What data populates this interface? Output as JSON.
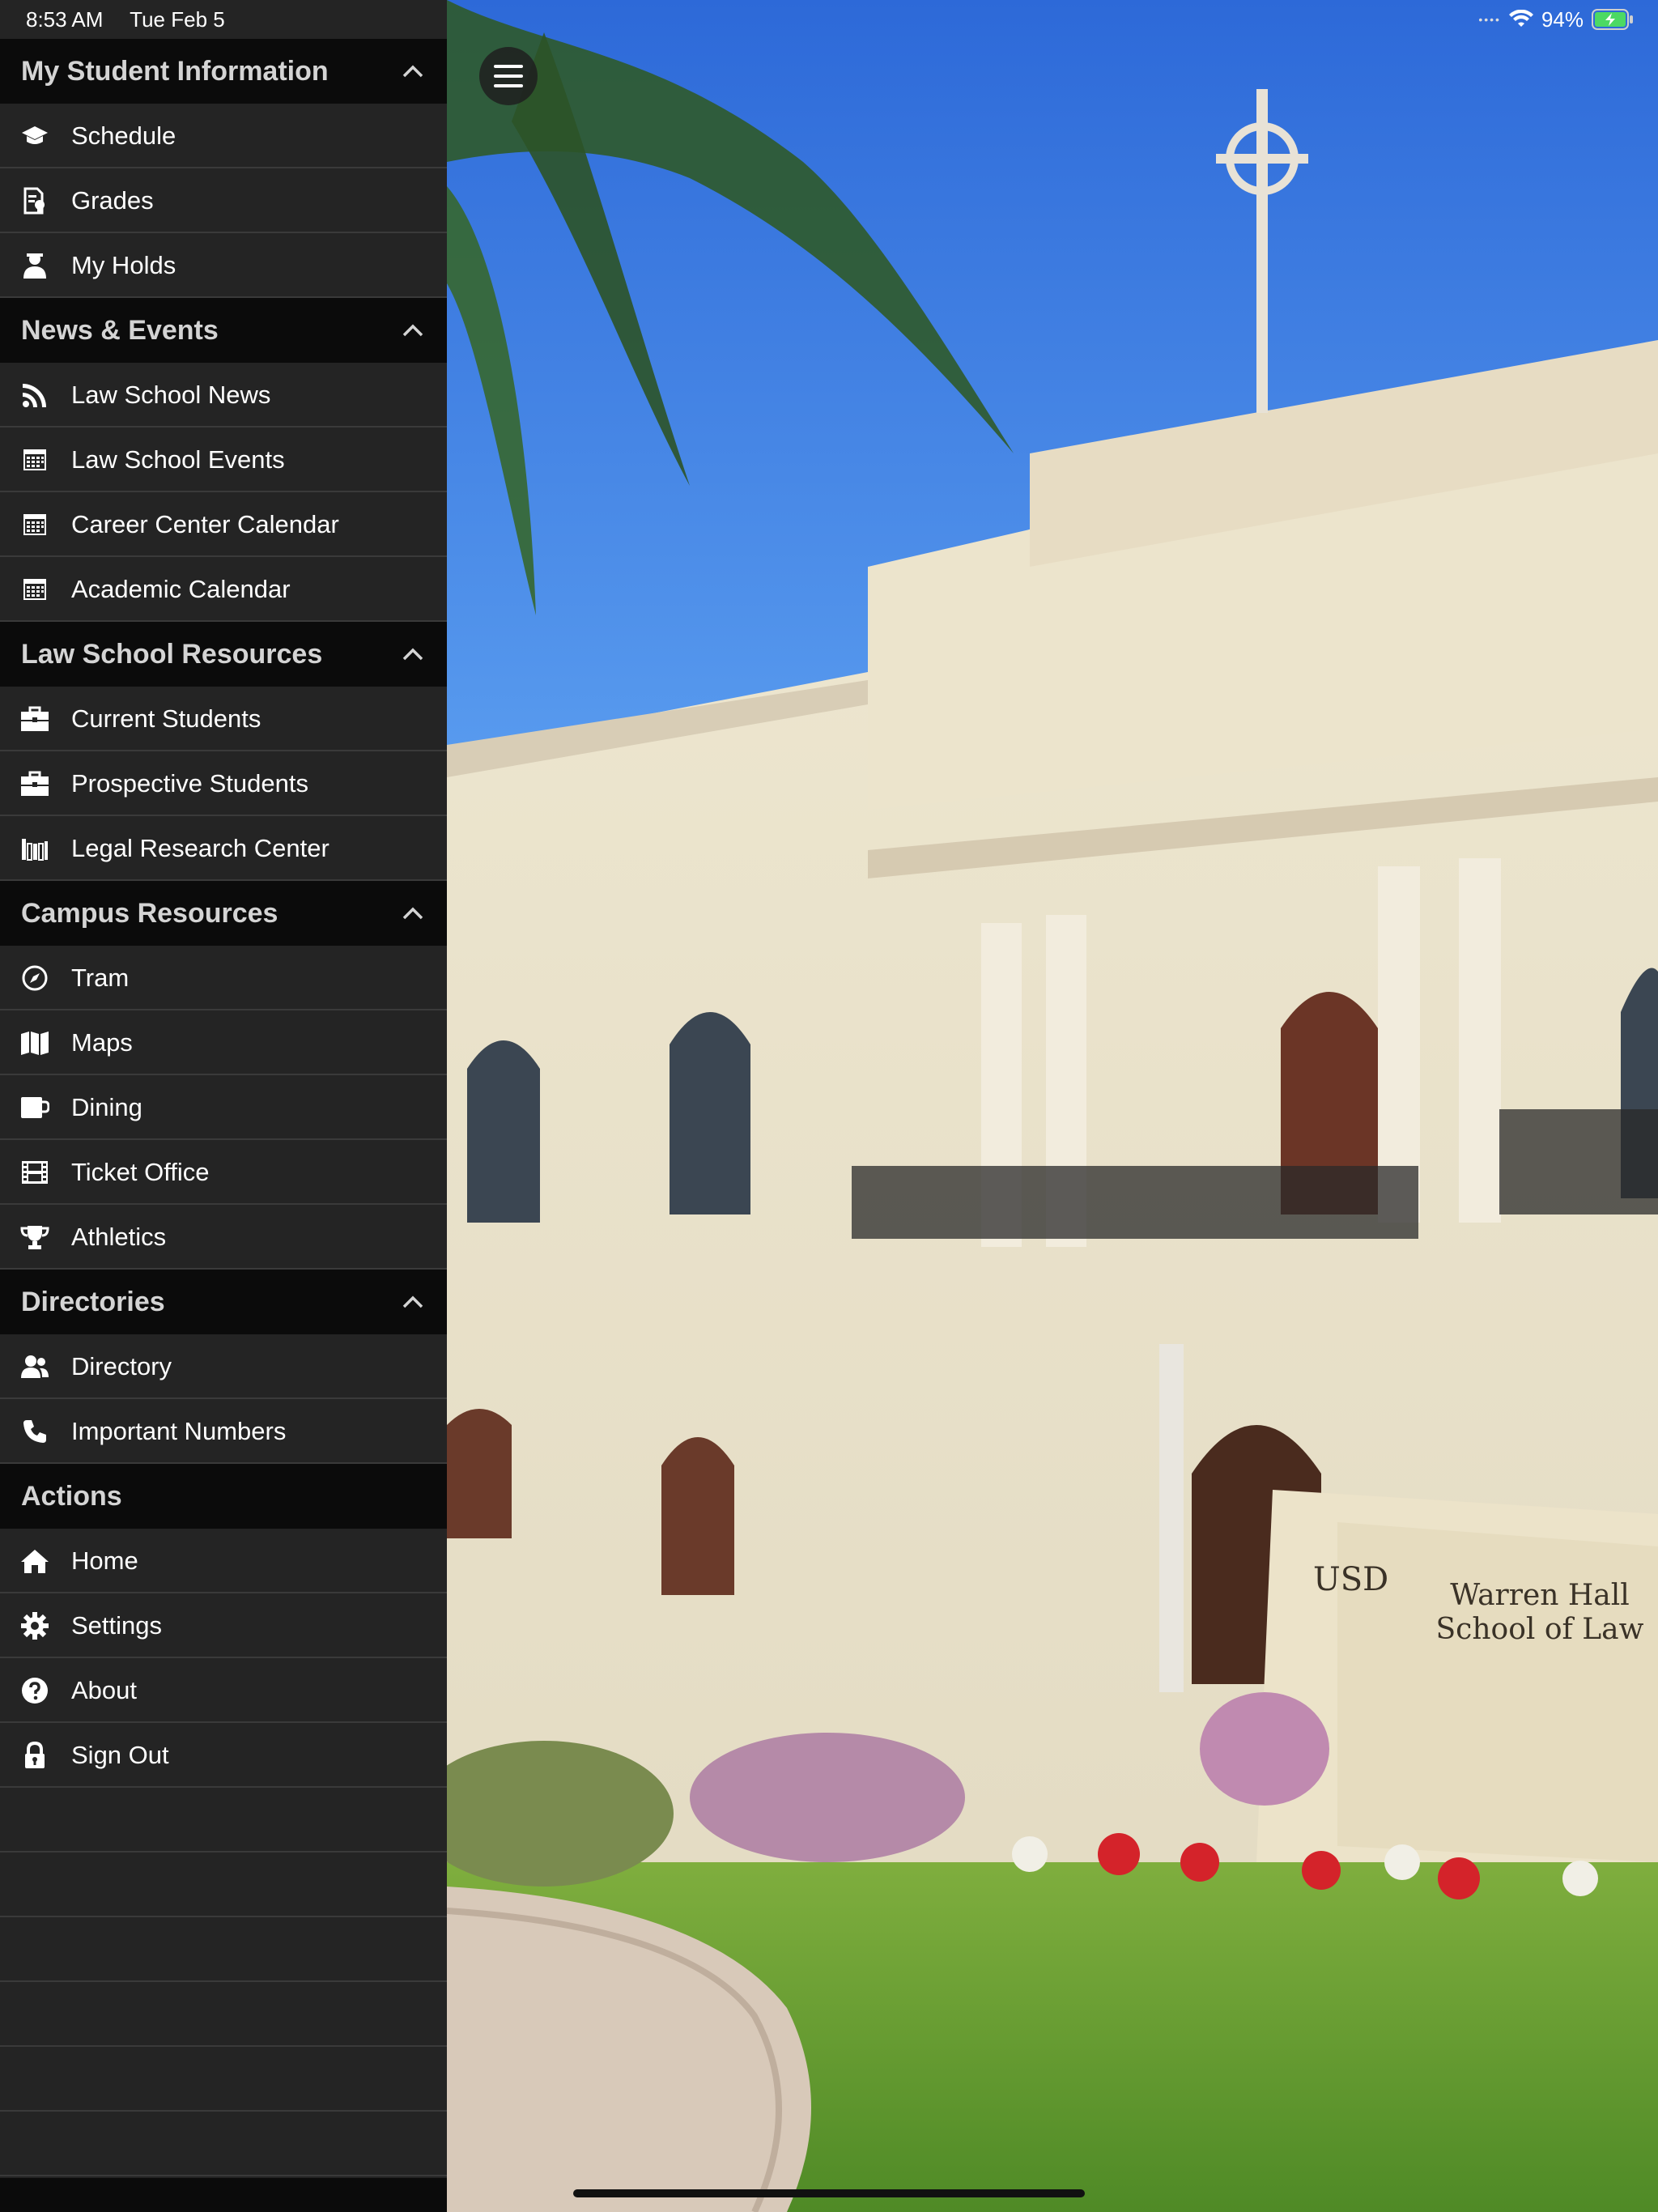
{
  "status_bar": {
    "time": "8:53 AM",
    "date": "Tue Feb 5",
    "battery": "94%"
  },
  "sidebar": {
    "sections": [
      {
        "title": "My Student Information",
        "collapsible": true,
        "items": [
          {
            "label": "Schedule",
            "icon": "graduation-cap-icon"
          },
          {
            "label": "Grades",
            "icon": "certificate-document-icon"
          },
          {
            "label": "My Holds",
            "icon": "user-hold-icon"
          }
        ]
      },
      {
        "title": "News & Events",
        "collapsible": true,
        "items": [
          {
            "label": "Law School News",
            "icon": "rss-icon"
          },
          {
            "label": "Law School Events",
            "icon": "calendar-icon"
          },
          {
            "label": "Career Center Calendar",
            "icon": "calendar-icon"
          },
          {
            "label": "Academic Calendar",
            "icon": "calendar-icon"
          }
        ]
      },
      {
        "title": "Law School Resources",
        "collapsible": true,
        "items": [
          {
            "label": "Current Students",
            "icon": "briefcase-icon"
          },
          {
            "label": "Prospective Students",
            "icon": "briefcase-icon"
          },
          {
            "label": "Legal Research Center",
            "icon": "library-books-icon"
          }
        ]
      },
      {
        "title": "Campus Resources",
        "collapsible": true,
        "items": [
          {
            "label": "Tram",
            "icon": "compass-icon"
          },
          {
            "label": "Maps",
            "icon": "map-icon"
          },
          {
            "label": "Dining",
            "icon": "coffee-cup-icon"
          },
          {
            "label": "Ticket Office",
            "icon": "film-icon"
          },
          {
            "label": "Athletics",
            "icon": "trophy-icon"
          }
        ]
      },
      {
        "title": "Directories",
        "collapsible": true,
        "items": [
          {
            "label": "Directory",
            "icon": "users-icon"
          },
          {
            "label": "Important Numbers",
            "icon": "phone-icon"
          }
        ]
      },
      {
        "title": "Actions",
        "collapsible": false,
        "items": [
          {
            "label": "Home",
            "icon": "home-icon"
          },
          {
            "label": "Settings",
            "icon": "gear-icon"
          },
          {
            "label": "About",
            "icon": "question-circle-icon"
          },
          {
            "label": "Sign Out",
            "icon": "lock-icon"
          }
        ]
      }
    ]
  },
  "photo": {
    "sign_line1": "Warren Hall",
    "sign_line2": "School of Law",
    "sign_logo": "USD"
  },
  "colors": {
    "sidebar_bg": "#242424",
    "header_bg": "#0b0b0b",
    "divider": "#3a3a3a",
    "battery_green": "#4cd964"
  }
}
